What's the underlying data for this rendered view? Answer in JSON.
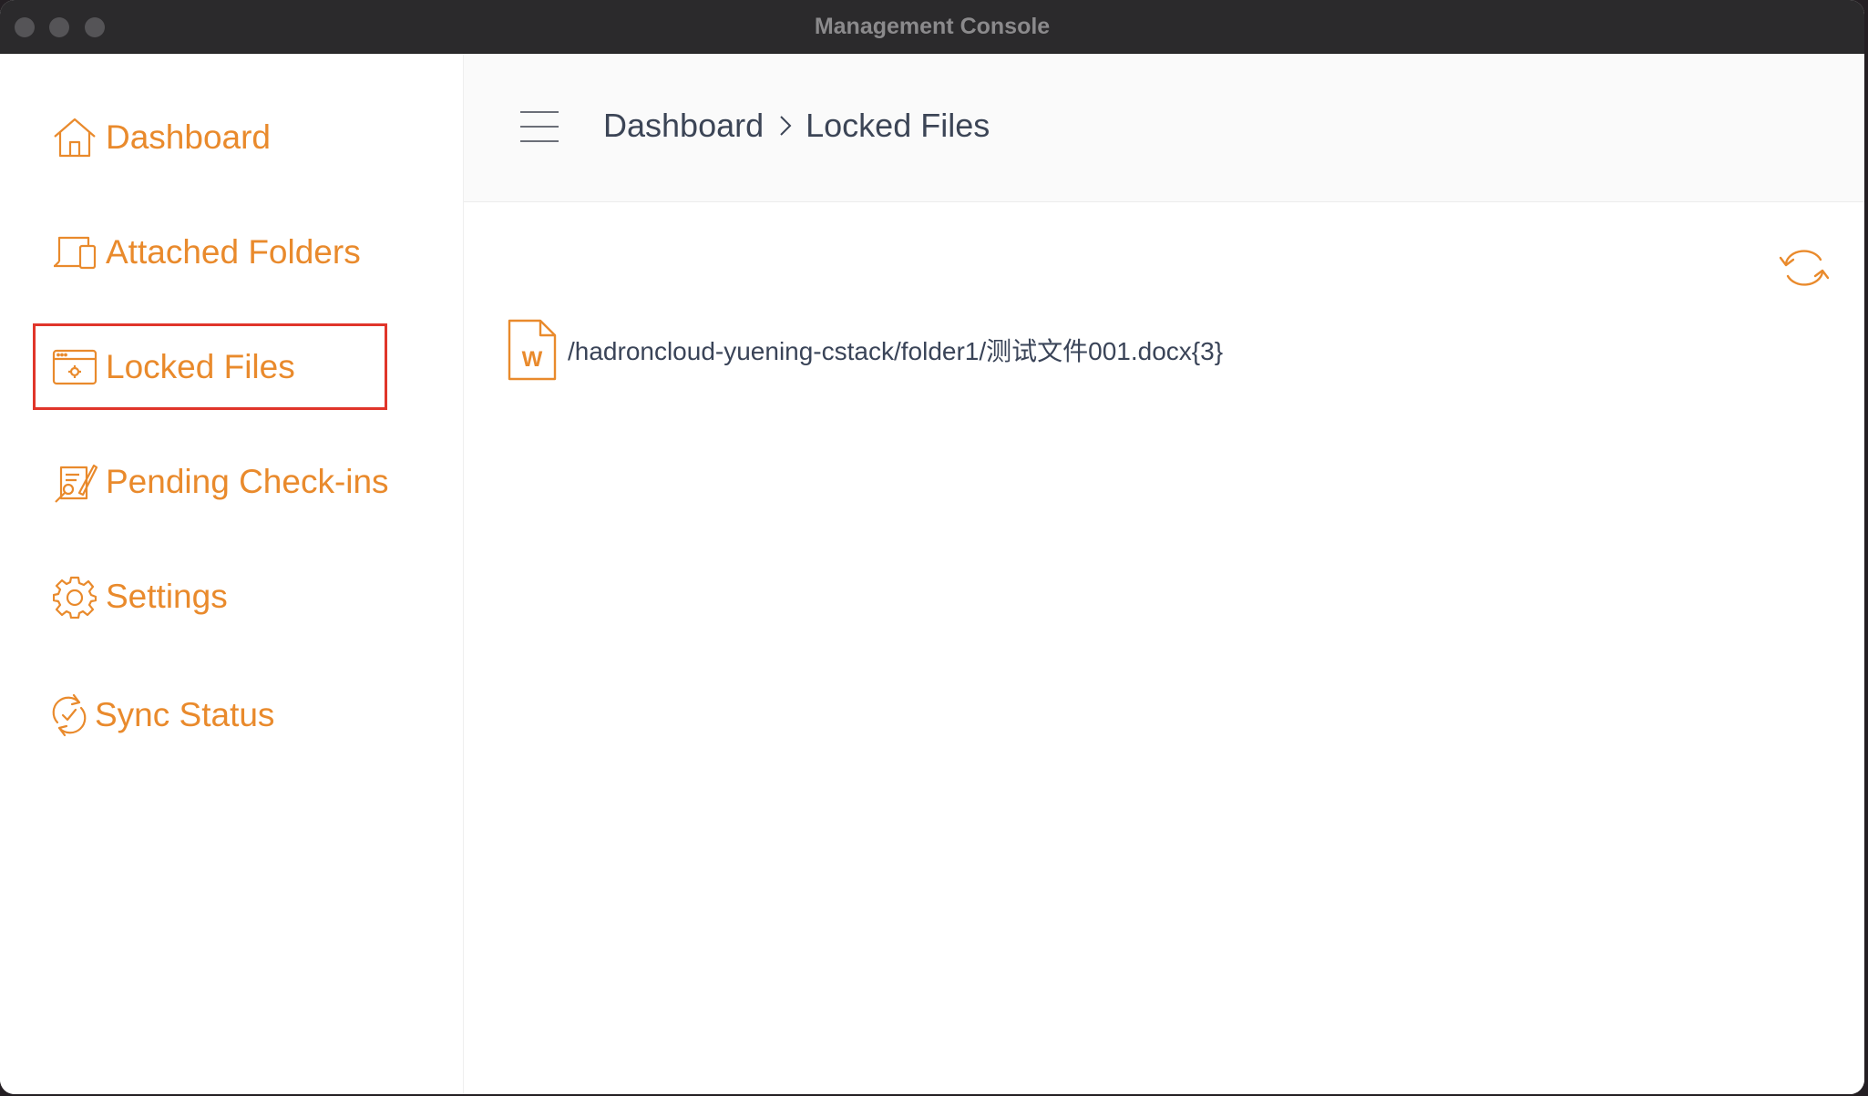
{
  "window": {
    "title": "Management Console"
  },
  "sidebar": {
    "items": [
      {
        "label": "Dashboard",
        "icon": "home-icon"
      },
      {
        "label": "Attached Folders",
        "icon": "devices-icon"
      },
      {
        "label": "Locked Files",
        "icon": "locked-window-icon",
        "selected": true
      },
      {
        "label": "Pending Check-ins",
        "icon": "edit-document-icon"
      },
      {
        "label": "Settings",
        "icon": "gear-icon"
      },
      {
        "label": "Sync Status",
        "icon": "sync-check-icon"
      }
    ]
  },
  "header": {
    "breadcrumb": [
      "Dashboard",
      "Locked Files"
    ]
  },
  "main": {
    "files": [
      {
        "path": "/hadroncloud-yuening-cstack/folder1/测试文件001.docx{3}",
        "icon": "word-file-icon",
        "icon_letter": "W"
      }
    ]
  },
  "colors": {
    "accent": "#e98a2c",
    "text": "#3c4556",
    "selection_border": "#e0352a",
    "titlebar": "#2b2a2c"
  }
}
